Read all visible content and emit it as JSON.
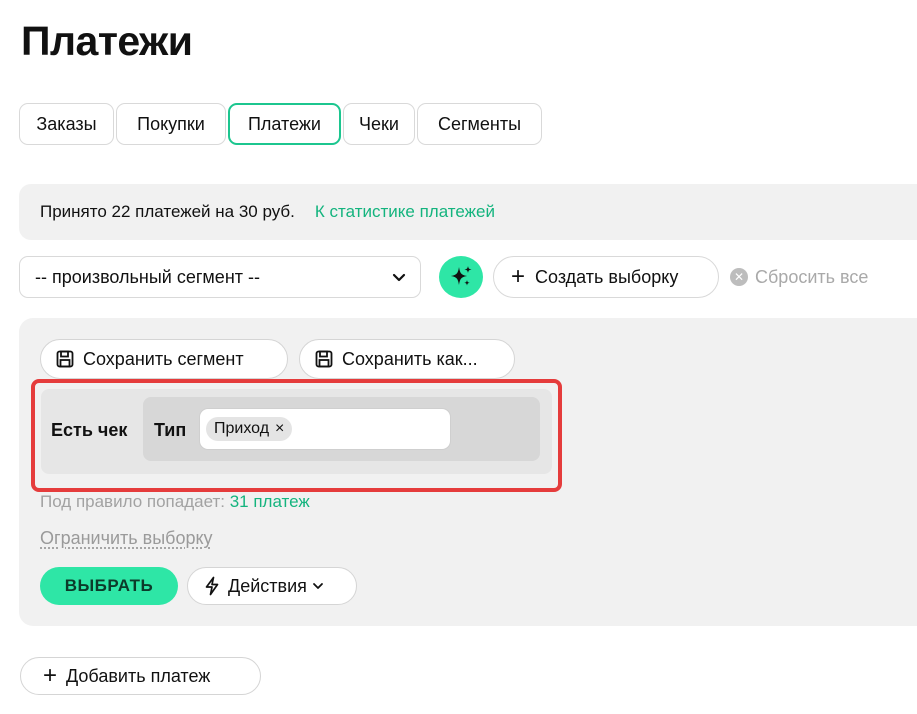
{
  "page": {
    "title": "Платежи"
  },
  "tabs": [
    {
      "label": "Заказы",
      "active": false
    },
    {
      "label": "Покупки",
      "active": false
    },
    {
      "label": "Платежи",
      "active": true
    },
    {
      "label": "Чеки",
      "active": false
    },
    {
      "label": "Сегменты",
      "active": false
    }
  ],
  "stats": {
    "text": "Принято 22 платежей на 30 руб.",
    "link": "К статистике платежей"
  },
  "filter": {
    "segment_selected": "-- произвольный сегмент --",
    "magic_icon": "sparkles-icon",
    "create_label": "Создать выборку",
    "reset_label": "Сбросить все"
  },
  "panel": {
    "save_segment": "Сохранить сегмент",
    "save_as": "Сохранить как...",
    "rule": {
      "label": "Есть чек",
      "condition_label": "Тип",
      "tag": "Приход",
      "tag_remove": "×"
    },
    "hint_text": "Под правило попадает:",
    "hint_count": "31 платеж",
    "limit_label": "Ограничить выборку",
    "choose_label": "ВЫБРАТЬ",
    "actions_label": "Действия"
  },
  "add_payment_label": "Добавить платеж",
  "colors": {
    "accent": "#2ee6a6",
    "link": "#14b47e",
    "highlight": "#e53c3c"
  }
}
